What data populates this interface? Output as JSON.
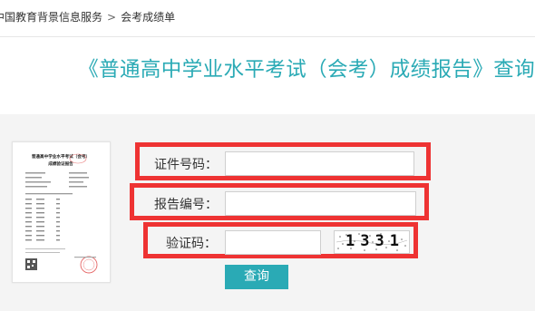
{
  "breadcrumb": {
    "home": "中国教育背景信息服务",
    "separator": ">",
    "current": "会考成绩单"
  },
  "title": "《普通高中学业水平考试（会考）成绩报告》查询",
  "thumbnail": {
    "heading_line1": "普通高中学业水平考试（会考）",
    "heading_line2": "成绩验证报告"
  },
  "form": {
    "id_number_label": "证件号码：",
    "id_number_value": "",
    "report_number_label": "报告编号：",
    "report_number_value": "",
    "captcha_label": "验证码：",
    "captcha_value": "",
    "captcha_text": "1331"
  },
  "query_button": "查询",
  "colors": {
    "accent": "#2aaab5",
    "highlight_border": "#ee3333",
    "panel_background": "#f4f4f4"
  }
}
